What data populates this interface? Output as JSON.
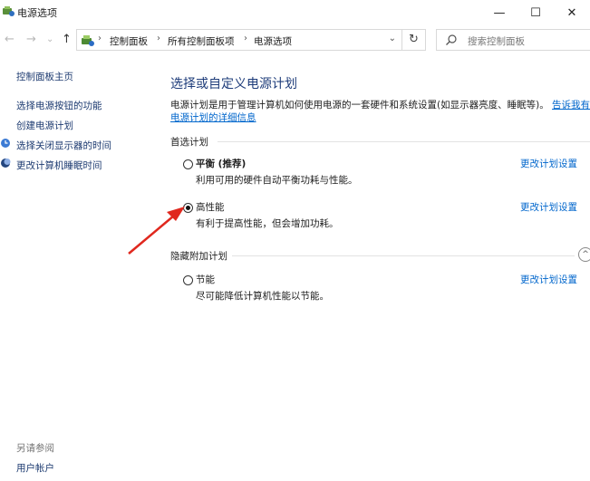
{
  "window": {
    "title": "电源选项",
    "minimize": "—",
    "maximize": "☐",
    "close": "✕"
  },
  "address": {
    "back": "←",
    "forward": "→",
    "history": "⌄",
    "up": "↑",
    "crumbs": [
      "控制面板",
      "所有控制面板项",
      "电源选项"
    ],
    "separator": "›",
    "dropdown": "⌄",
    "refresh": "↻",
    "search_placeholder": "搜索控制面板"
  },
  "sidebar": {
    "home": "控制面板主页",
    "items": [
      "选择电源按钮的功能",
      "创建电源计划",
      "选择关闭显示器的时间",
      "更改计算机睡眠时间"
    ],
    "see_also": "另请参阅",
    "user_accounts": "用户帐户"
  },
  "main": {
    "heading": "选择或自定义电源计划",
    "description": "电源计划是用于管理计算机如何使用电源的一套硬件和系统设置(如显示器亮度、睡眠等)。",
    "tell_more": "告诉我有关",
    "details_link": "电源计划的详细信息",
    "preferred_label": "首选计划",
    "hidden_label": "隐藏附加计划",
    "collapse_glyph": "^",
    "plans": [
      {
        "name": "平衡 (推荐)",
        "desc": "利用可用的硬件自动平衡功耗与性能。",
        "change": "更改计划设置",
        "selected": false
      },
      {
        "name": "高性能",
        "desc": "有利于提高性能，但会增加功耗。",
        "change": "更改计划设置",
        "selected": true
      },
      {
        "name": "节能",
        "desc": "尽可能降低计算机性能以节能。",
        "change": "更改计划设置",
        "selected": false
      }
    ]
  },
  "colors": {
    "accent_link": "#0066cc",
    "heading": "#1e3c7a",
    "annotation_arrow": "#e0281e"
  }
}
